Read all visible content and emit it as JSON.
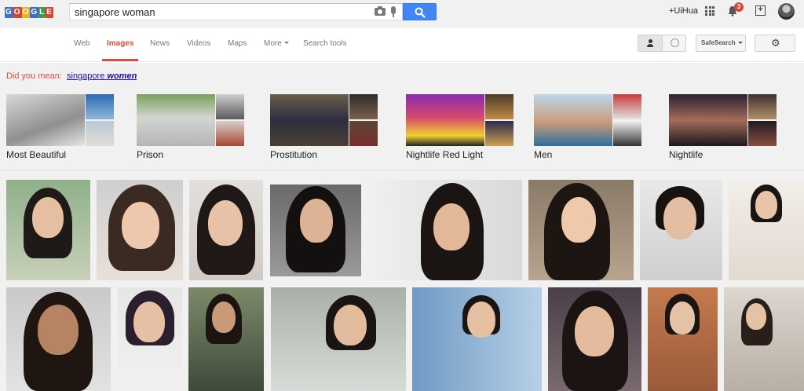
{
  "header": {
    "logo_letters": [
      "G",
      "O",
      "O",
      "G",
      "L",
      "E"
    ],
    "logo_colors": [
      "#3b6fc9",
      "#d64433",
      "#e6b321",
      "#3b6fc9",
      "#3f9b49",
      "#d64433"
    ],
    "search_value": "singapore woman",
    "user_name": "+UiHua",
    "notification_count": "3"
  },
  "nav": {
    "tabs": [
      {
        "label": "Web",
        "active": false
      },
      {
        "label": "Images",
        "active": true
      },
      {
        "label": "News",
        "active": false
      },
      {
        "label": "Videos",
        "active": false
      },
      {
        "label": "Maps",
        "active": false
      },
      {
        "label": "More",
        "active": false
      },
      {
        "label": "Search tools",
        "active": false
      }
    ],
    "safesearch_label": "SafeSearch"
  },
  "suggestion": {
    "prefix": "Did you mean:",
    "term_plain": "singapore",
    "term_emphasis": "women"
  },
  "related_searches": [
    {
      "label": "Most Beautiful"
    },
    {
      "label": "Prison"
    },
    {
      "label": "Prostitution"
    },
    {
      "label": "Nightlife Red Light"
    },
    {
      "label": "Men"
    },
    {
      "label": "Nightlife"
    }
  ],
  "colors": {
    "accent_red": "#dd4b39",
    "link_blue": "#1a0dab",
    "search_button_blue": "#4285f4",
    "badge_red": "#db4437",
    "page_background": "#f1f1f1"
  }
}
